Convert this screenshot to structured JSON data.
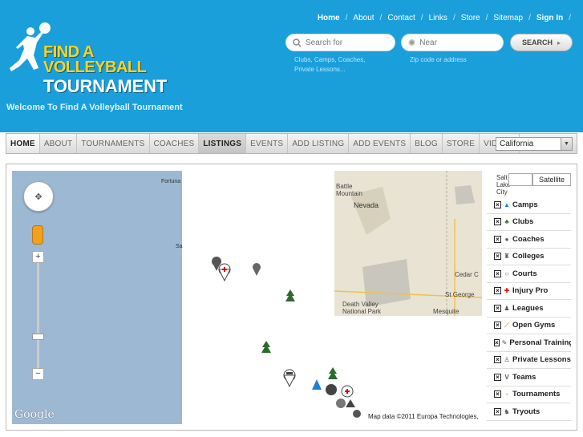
{
  "brand": {
    "line1": "FIND A",
    "line2": "VOLLEYBALL",
    "line3": "TOURNAMENT",
    "welcome": "Welcome To Find A Volleyball Tournament",
    "accent_yellow": "#ffd21e",
    "header_blue": "#1a9fdb"
  },
  "topnav": [
    "Home",
    "About",
    "Contact",
    "Links",
    "Store",
    "Sitemap",
    "Sign In"
  ],
  "search": {
    "what_placeholder": "Search for",
    "near_placeholder": "Near",
    "button_label": "SEARCH",
    "what_hint": "Clubs, Camps, Coaches, Private Lessons...",
    "near_hint": "Zip code or address"
  },
  "mainnav": {
    "tabs": [
      "HOME",
      "ABOUT",
      "TOURNAMENTS",
      "COACHES",
      "LISTINGS",
      "EVENTS",
      "ADD LISTING",
      "ADD EVENTS",
      "BLOG",
      "STORE",
      "VIDEOS"
    ],
    "active": "LISTINGS",
    "state_selected": "California"
  },
  "map": {
    "satellite_label": "Satellite",
    "google_label": "Google",
    "attribution": "Map data ©2011 Europa Technologies,",
    "labels": {
      "fortuna": "Fortuna",
      "sa": "Sa",
      "battle_mountain": "Battle Mountain",
      "nevada": "Nevada",
      "death_valley": "Death Valley National Park",
      "st_george": "St George",
      "mesquite": "Mesquite",
      "cedar_city": "Cedar C",
      "salt_lake": "Salt Lake City"
    },
    "legend": [
      {
        "label": "Camps",
        "icon": "camps-icon"
      },
      {
        "label": "Clubs",
        "icon": "clubs-icon"
      },
      {
        "label": "Coaches",
        "icon": "coaches-icon"
      },
      {
        "label": "Colleges",
        "icon": "colleges-icon"
      },
      {
        "label": "Courts",
        "icon": "courts-icon"
      },
      {
        "label": "Injury Pro",
        "icon": "injury-pro-icon"
      },
      {
        "label": "Leagues",
        "icon": "leagues-icon"
      },
      {
        "label": "Open Gyms",
        "icon": "open-gyms-icon"
      },
      {
        "label": "Personal Training",
        "icon": "personal-training-icon"
      },
      {
        "label": "Private Lessons",
        "icon": "private-lessons-icon"
      },
      {
        "label": "Teams",
        "icon": "teams-icon"
      },
      {
        "label": "Tournaments",
        "icon": "tournaments-icon"
      },
      {
        "label": "Tryouts",
        "icon": "tryouts-icon"
      }
    ]
  }
}
